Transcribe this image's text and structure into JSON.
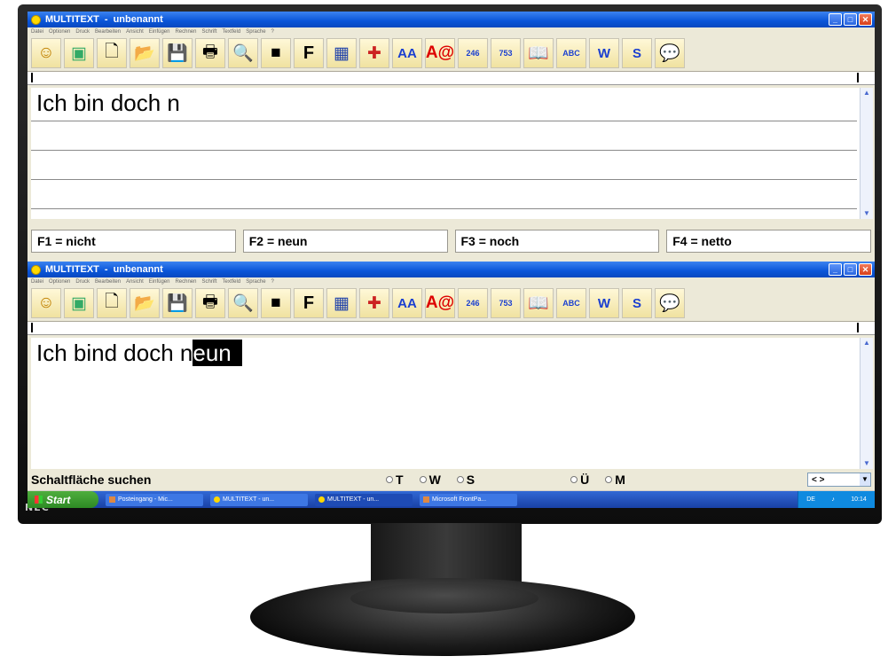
{
  "monitor": {
    "brand": "NEC"
  },
  "windows": [
    {
      "title": "MULTITEXT",
      "document": "unbenannt",
      "menu": [
        "Datei",
        "Optionen",
        "Druck",
        "Bearbeiten",
        "Ansicht",
        "Einfügen",
        "Rechnen",
        "Schrift",
        "Textfeld",
        "Sprache",
        "?"
      ],
      "editor_text": "Ich bin doch n",
      "fkeys": [
        "F1 = nicht",
        "F2 = neun",
        "F3 = noch",
        "F4 = netto"
      ]
    },
    {
      "title": "MULTITEXT",
      "document": "unbenannt",
      "menu": [
        "Datei",
        "Optionen",
        "Druck",
        "Bearbeiten",
        "Ansicht",
        "Einfügen",
        "Rechnen",
        "Schrift",
        "Textfeld",
        "Sprache",
        "?"
      ],
      "editor_text": "Ich bind doch n",
      "editor_selection": "eun",
      "status": {
        "search_label": "Schaltfläche suchen",
        "options": [
          "T",
          "W",
          "S",
          "Ü",
          "M"
        ],
        "combo_value": "< >"
      }
    }
  ],
  "toolbar_glyphs": {
    "smiley": "☺",
    "new": "🗋",
    "open": "📂",
    "save": "💾",
    "print": "🖶",
    "preview": "🔍",
    "square": "■",
    "font": "F",
    "calculator": "▦",
    "grid": "✚",
    "aa": "AA",
    "a_at": "A@",
    "num1": "246",
    "num2": "753",
    "book": "📖",
    "abc": "ABC",
    "w": "W",
    "s": "S",
    "bubble": "💬"
  },
  "taskbar": {
    "start_label": "Start",
    "tasks": [
      "Posteingang - Mic...",
      "MULTITEXT - un...",
      "MULTITEXT - un...",
      "Microsoft FrontPa..."
    ],
    "tray_lang": "DE",
    "tray_time": "10:14"
  },
  "colors": {
    "titlebar": "#0a55d8",
    "taskbar": "#1941a5",
    "selection": "#000000"
  }
}
